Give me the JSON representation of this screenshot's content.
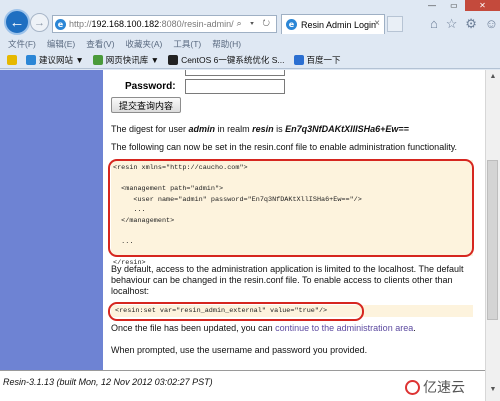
{
  "browser": {
    "url_prefix": "http://",
    "url_host": "192.168.100.182",
    "url_rest": ":8080/resin-admin/",
    "addr_controls": "⌕ ▾ ↻",
    "tab_title": "Resin Admin Login",
    "menu": [
      "文件(F)",
      "编辑(E)",
      "查看(V)",
      "收藏夹(A)",
      "工具(T)",
      "帮助(H)"
    ],
    "favorites": [
      "建议网站 ▼",
      "网页快讯库 ▼",
      "CentOS 6一键系统优化 S...",
      "百度一下"
    ]
  },
  "form": {
    "password_label": "Password:",
    "submit_label": "提交查询内容"
  },
  "content": {
    "digest_prefix": "The digest for user ",
    "digest_user": "admin",
    "digest_mid": " in realm ",
    "digest_realm": "resin",
    "digest_is": " is ",
    "digest_value": "En7q3NfDAKtXllISHa6+Ew==",
    "set_line": "The following can now be set in the resin.conf file to enable administration functionality.",
    "code_block_1": "<resin xmlns=\"http://caucho.com\">\n\n  <management path=\"admin\">\n     <user name=\"admin\" password=\"En7q3NfDAKtXllISHa6+Ew==\"/>\n     ...\n  </management>\n\n  ...\n\n</resin>",
    "default_text": "By default, access to the administration application is limited to the localhost. The default behaviour can be changed in the resin.conf file. To enable access to clients other than localhost:",
    "code_block_2": "<resin:set var=\"resin_admin_external\" value=\"true\"/>",
    "updated_prefix": "Once the file has been updated, you can ",
    "updated_link": "continue to the administration area",
    "updated_suffix": ".",
    "prompted": "When prompted, use the username and password you provided."
  },
  "footer": {
    "version": "Resin-3.1.13 (built Mon, 12 Nov 2012 03:02:27 PST)",
    "watermark": "亿速云"
  }
}
